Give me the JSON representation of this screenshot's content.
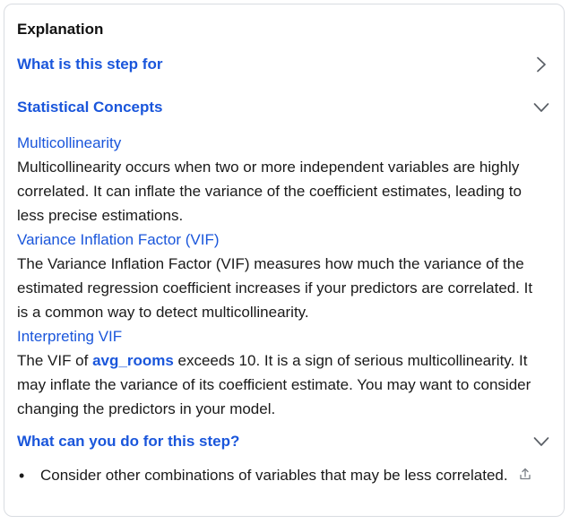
{
  "panel": {
    "title": "Explanation",
    "sections": [
      {
        "label": "What is this step for",
        "state": "collapsed"
      },
      {
        "label": "Statistical Concepts",
        "state": "expanded"
      },
      {
        "label": "What can you do for this step?",
        "state": "expanded"
      }
    ],
    "concepts": [
      {
        "heading": "Multicollinearity",
        "text": "Multicollinearity occurs when two or more independent variables are highly correlated. It can inflate the variance of the coefficient estimates, leading to less precise estimations."
      },
      {
        "heading": "Variance Inflation Factor (VIF)",
        "text": "The Variance Inflation Factor (VIF) measures how much the variance of the estimated regression coefficient increases if your predictors are correlated. It is a common way to detect multicollinearity."
      },
      {
        "heading": "Interpreting VIF",
        "text_before": "The VIF of ",
        "variable": "avg_rooms",
        "text_after": " exceeds 10. It is a sign of serious multicollinearity. It may inflate the variance of its coefficient estimate. You may want to consider changing the predictors in your model."
      }
    ],
    "suggestions": [
      "Consider other combinations of variables that may be less correlated."
    ],
    "colors": {
      "accent": "#1a56db",
      "border": "#d9dce1",
      "text": "#1a1a1a"
    },
    "icons": [
      "chevron-right-icon",
      "chevron-down-icon",
      "share-icon"
    ]
  }
}
